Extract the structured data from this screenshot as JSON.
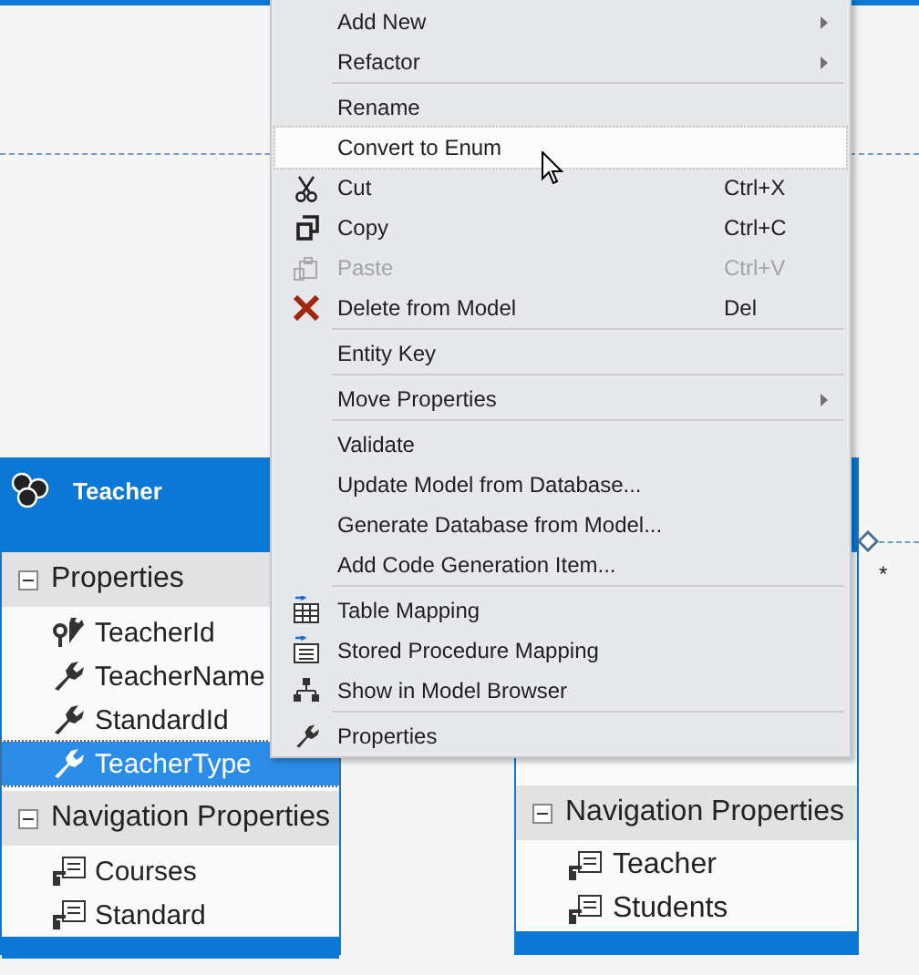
{
  "entities": [
    {
      "name": "Teacher",
      "sections": [
        {
          "title": "Properties",
          "expanded": true,
          "items": [
            {
              "label": "TeacherId",
              "kind": "key",
              "selected": false
            },
            {
              "label": "TeacherName",
              "kind": "property",
              "selected": false
            },
            {
              "label": "StandardId",
              "kind": "property",
              "selected": false
            },
            {
              "label": "TeacherType",
              "kind": "property",
              "selected": true
            }
          ]
        },
        {
          "title": "Navigation Properties",
          "expanded": true,
          "items": [
            {
              "label": "Courses",
              "kind": "navigation",
              "selected": false
            },
            {
              "label": "Standard",
              "kind": "navigation",
              "selected": false
            }
          ]
        }
      ]
    },
    {
      "sections": [
        {
          "title": "Navigation Properties",
          "expanded": true,
          "items": [
            {
              "label": "Teacher",
              "kind": "navigation",
              "selected": false
            },
            {
              "label": "Students",
              "kind": "navigation",
              "selected": false
            }
          ]
        }
      ]
    }
  ],
  "association": {
    "multiplicity": "*"
  },
  "context_menu": [
    {
      "kind": "item",
      "label": "Add New",
      "submenu": true,
      "selected": false
    },
    {
      "kind": "item",
      "label": "Refactor",
      "submenu": true,
      "selected": false
    },
    {
      "kind": "separator"
    },
    {
      "kind": "item",
      "label": "Rename",
      "selected": false
    },
    {
      "kind": "item",
      "label": "Convert to Enum",
      "selected": true
    },
    {
      "kind": "item",
      "label": "Cut",
      "shortcut": "Ctrl+X",
      "selected": false
    },
    {
      "kind": "item",
      "label": "Copy",
      "shortcut": "Ctrl+C",
      "selected": false
    },
    {
      "kind": "item",
      "label": "Paste",
      "shortcut": "Ctrl+V",
      "disabled": true,
      "selected": false
    },
    {
      "kind": "item",
      "label": "Delete from Model",
      "shortcut": "Del",
      "selected": false
    },
    {
      "kind": "separator"
    },
    {
      "kind": "item",
      "label": "Entity Key",
      "selected": false
    },
    {
      "kind": "separator"
    },
    {
      "kind": "item",
      "label": "Move Properties",
      "submenu": true,
      "selected": false
    },
    {
      "kind": "separator"
    },
    {
      "kind": "item",
      "label": "Validate",
      "selected": false
    },
    {
      "kind": "item",
      "label": "Update Model from Database...",
      "selected": false
    },
    {
      "kind": "item",
      "label": "Generate Database from Model...",
      "selected": false
    },
    {
      "kind": "item",
      "label": "Add Code Generation Item...",
      "selected": false
    },
    {
      "kind": "separator"
    },
    {
      "kind": "item",
      "label": "Table Mapping",
      "selected": false
    },
    {
      "kind": "item",
      "label": "Stored Procedure Mapping",
      "selected": false
    },
    {
      "kind": "item",
      "label": "Show in Model Browser",
      "selected": false
    },
    {
      "kind": "separator"
    },
    {
      "kind": "item",
      "label": "Properties",
      "selected": false
    }
  ]
}
